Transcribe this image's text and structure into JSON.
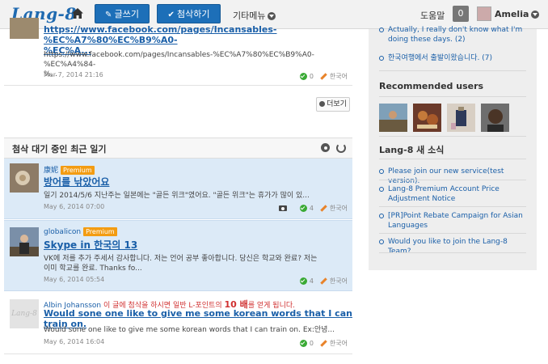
{
  "header": {
    "logo": "Lang-8",
    "write_label": "글쓰기",
    "correct_label": "첨삭하기",
    "more_label": "기타메뉴",
    "help_label": "도움말",
    "notification_count": "0",
    "user_name": "Amelia"
  },
  "top_entry": {
    "title_line1": "https://www.facebook.com/pages/Incansables-%EC%A7%80%EC%B9%A0-",
    "title_line2": "%EC%A...",
    "body_line1": "https://www.facebook.com/pages/Incansables-%EC%A7%80%EC%B9%A0-%EC%A4%84-",
    "body_line2": "%...",
    "date": "Mar 7, 2014 21:16",
    "corrections": "0",
    "language": "한국어"
  },
  "more_button": "더보기",
  "section": {
    "title": "첨삭 대기 중인 최근 일기"
  },
  "entries": [
    {
      "author": "康妮",
      "premium": "Premium",
      "title": "방어를 낚았어요",
      "body": "일기 2014/5/6 지난주는 일본에는 \"골든 위크\"였어요. \"골든 위크\"는 휴가가 많이 있...",
      "date": "May 6, 2014 07:00",
      "corrections": "4",
      "language": "한국어"
    },
    {
      "author": "globalicon",
      "premium": "Premium",
      "title": "Skype in 한국의 13",
      "body_line1": "VK에 저를 추가 주세서 감사합니다. 저는 언어 공부 좋아합니다. 당신은 학교와 완료? 저는",
      "body_line2": "이미 학교를 완료. Thanks fo...",
      "date": "May 6, 2014 05:54",
      "corrections": "4",
      "language": "한국어"
    },
    {
      "author": "Albin Johansson",
      "promo_pre": "이 글에 첨삭을 하시면 일반 L-포인트의",
      "promo_num": "10 배",
      "promo_post": "를 얻게 됩니다.",
      "title": "Would sone one like to give me some korean words that I can train on.",
      "body": "Would sone one like to give me some korean words that I can train on. Ex:안녕...",
      "date": "May 6, 2014 16:04",
      "corrections": "0",
      "language": "한국어"
    }
  ],
  "sidebar": {
    "activity": [
      {
        "line1": "Actually, I really don't know what I'm",
        "line2": "doing these days. (2)"
      },
      {
        "line1": "한국여행에서 출발이왔습니다. (7)"
      }
    ],
    "recommended_heading": "Recommended users",
    "news_heading": "Lang-8 새 소식",
    "news": [
      {
        "line1": "Please join our new service(test version)."
      },
      {
        "line1": "Lang-8 Premium Account Price",
        "line2": "Adjustment Notice"
      },
      {
        "line1": "[PR]Point Rebate Campaign for Asian",
        "line2": "Languages"
      },
      {
        "line1": "Would you like to join the Lang-8 Team?"
      }
    ]
  }
}
